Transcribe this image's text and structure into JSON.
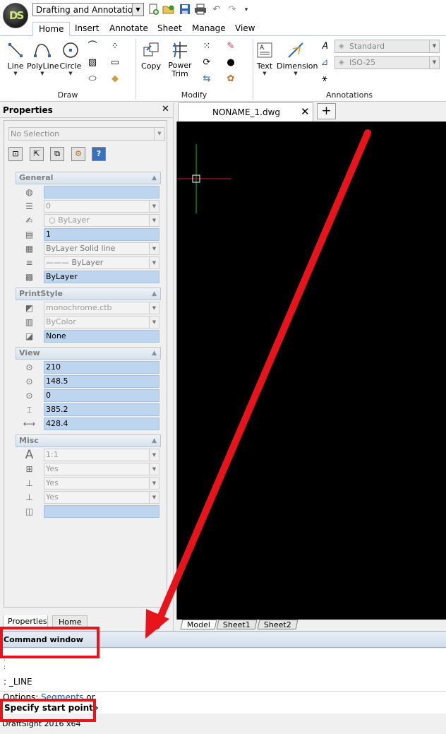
{
  "app": {
    "logo_text": "DS",
    "workspace": "Drafting and Annotation",
    "version_text": "DraftSight 2016 x64"
  },
  "quick_access": [
    "new-file-icon",
    "open-folder-icon",
    "save-icon",
    "print-icon",
    "undo-icon",
    "redo-icon",
    "customize-icon"
  ],
  "ribbon": {
    "tabs": [
      {
        "label": "Home",
        "active": true
      },
      {
        "label": "Insert",
        "active": false
      },
      {
        "label": "Annotate",
        "active": false
      },
      {
        "label": "Sheet",
        "active": false
      },
      {
        "label": "Manage",
        "active": false
      },
      {
        "label": "View",
        "active": false
      }
    ],
    "groups": {
      "draw": {
        "title": "Draw",
        "buttons": [
          "Line",
          "PolyLine",
          "Circle"
        ]
      },
      "modify": {
        "title": "Modify",
        "buttons": [
          "Copy",
          "Power\nTrim"
        ],
        "copy": "Copy",
        "power": "Power",
        "trim": "Trim"
      },
      "annotations": {
        "title": "Annotations",
        "buttons": [
          "Text",
          "Dimension"
        ],
        "text_style": "Standard",
        "dim_style": "ISO-25"
      }
    }
  },
  "properties": {
    "title": "Properties",
    "selection": "No Selection",
    "sections": {
      "general": {
        "title": "General",
        "rows": [
          "",
          "0",
          "ByLayer",
          "1",
          "ByLayer     Solid line",
          "——— ByLayer",
          "ByLayer"
        ]
      },
      "printstyle": {
        "title": "PrintStyle",
        "rows": [
          "monochrome.ctb",
          "ByColor",
          "None"
        ]
      },
      "view": {
        "title": "View",
        "rows": [
          "210",
          "148.5",
          "0",
          "385.2",
          "428.4"
        ]
      },
      "misc": {
        "title": "Misc",
        "rows": [
          "1:1",
          "Yes",
          "Yes",
          "Yes",
          ""
        ]
      }
    },
    "tabs": [
      "Properties",
      "Home"
    ]
  },
  "document": {
    "tab_label": "NONAME_1.dwg",
    "layout_tabs": [
      "Model",
      "Sheet1",
      "Sheet2"
    ]
  },
  "command": {
    "title": "Command window",
    "history": [
      ":",
      ":",
      ": _LINE"
    ],
    "options_label": "Options:",
    "options_link": "Segments",
    "options_tail": "or",
    "prompt": "Specify start point»"
  },
  "colors": {
    "annotation": "#e8141c",
    "canvas": "#000000",
    "crosshair_x": "#d42020",
    "crosshair_y": "#22b022"
  }
}
